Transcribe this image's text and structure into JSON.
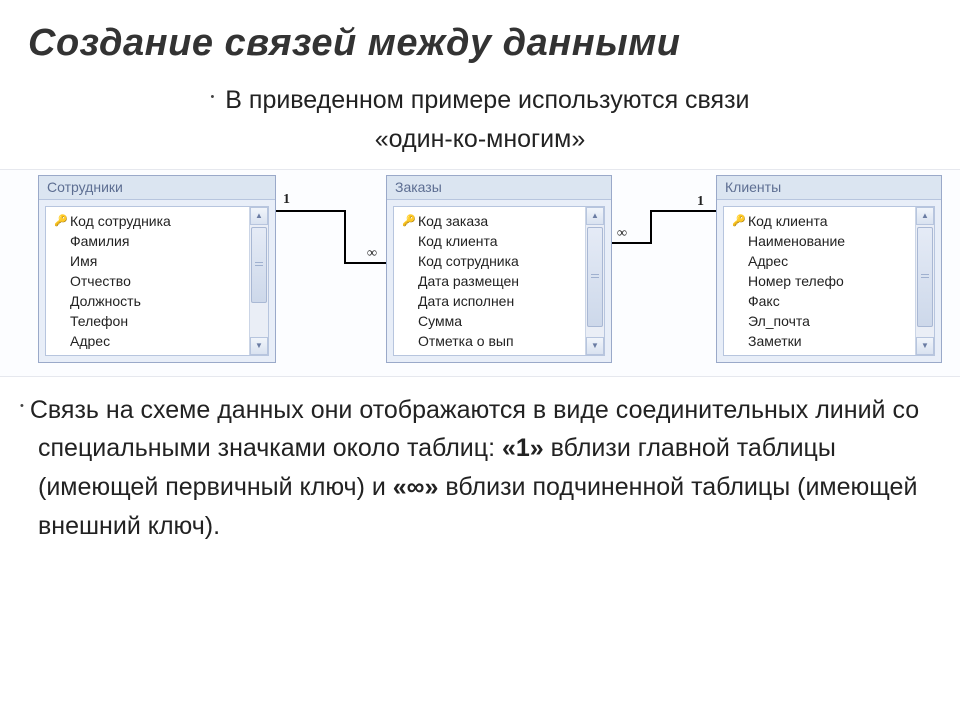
{
  "title": "Создание связей между данными",
  "intro_line1": "В приведенном примере используются связи",
  "intro_line2": "«один-ко-многим»",
  "tables": {
    "employees": {
      "title": "Сотрудники",
      "fields": [
        "Код сотрудника",
        "Фамилия",
        "Имя",
        "Отчество",
        "Должность",
        "Телефон",
        "Адрес"
      ],
      "pkIndex": 0
    },
    "orders": {
      "title": "Заказы",
      "fields": [
        "Код заказа",
        "Код клиента",
        "Код сотрудника",
        "Дата размещен",
        "Дата исполнен",
        "Сумма",
        "Отметка о вып"
      ],
      "pkIndex": 0
    },
    "clients": {
      "title": "Клиенты",
      "fields": [
        "Код клиента",
        "Наименование",
        "Адрес",
        "Номер телефо",
        "Факс",
        "Эл_почта",
        "Заметки"
      ],
      "pkIndex": 0
    }
  },
  "relations": {
    "one_label": "1",
    "many_label": "∞"
  },
  "body_text": {
    "p1a": "Связь на схеме данных они отображаются в виде соединительных линий со специальными значками около таблиц: ",
    "p1b": "«1»",
    "p1c": " вблизи главной таблицы (имеющей первичный ключ) и ",
    "p1d": "«∞»",
    "p1e": " вблизи подчиненной таблицы (имеющей внешний ключ)."
  }
}
